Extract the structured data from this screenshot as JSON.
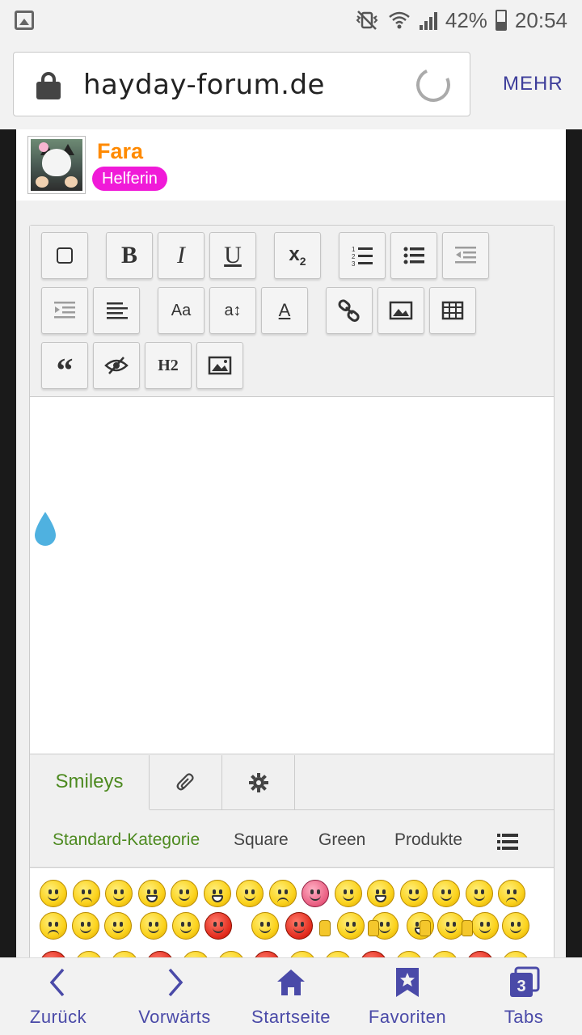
{
  "status_bar": {
    "battery": "42%",
    "time": "20:54"
  },
  "browser": {
    "url": "hayday-forum.de",
    "menu_label": "MEHR"
  },
  "user": {
    "name": "Fara",
    "role": "Helferin"
  },
  "editor_tabs": {
    "smileys": "Smileys"
  },
  "smiley_categories": [
    "Standard-Kategorie",
    "Square",
    "Green",
    "Produkte"
  ],
  "bottom_nav": {
    "back": "Zurück",
    "forward": "Vorwärts",
    "home": "Startseite",
    "favorites": "Favoriten",
    "tabs": "Tabs",
    "tabs_count": "3"
  },
  "colors": {
    "username": "#ff8a00",
    "role_badge": "#f01ad8",
    "active_tab": "#4d8a20",
    "nav": "#4a4aa8"
  }
}
